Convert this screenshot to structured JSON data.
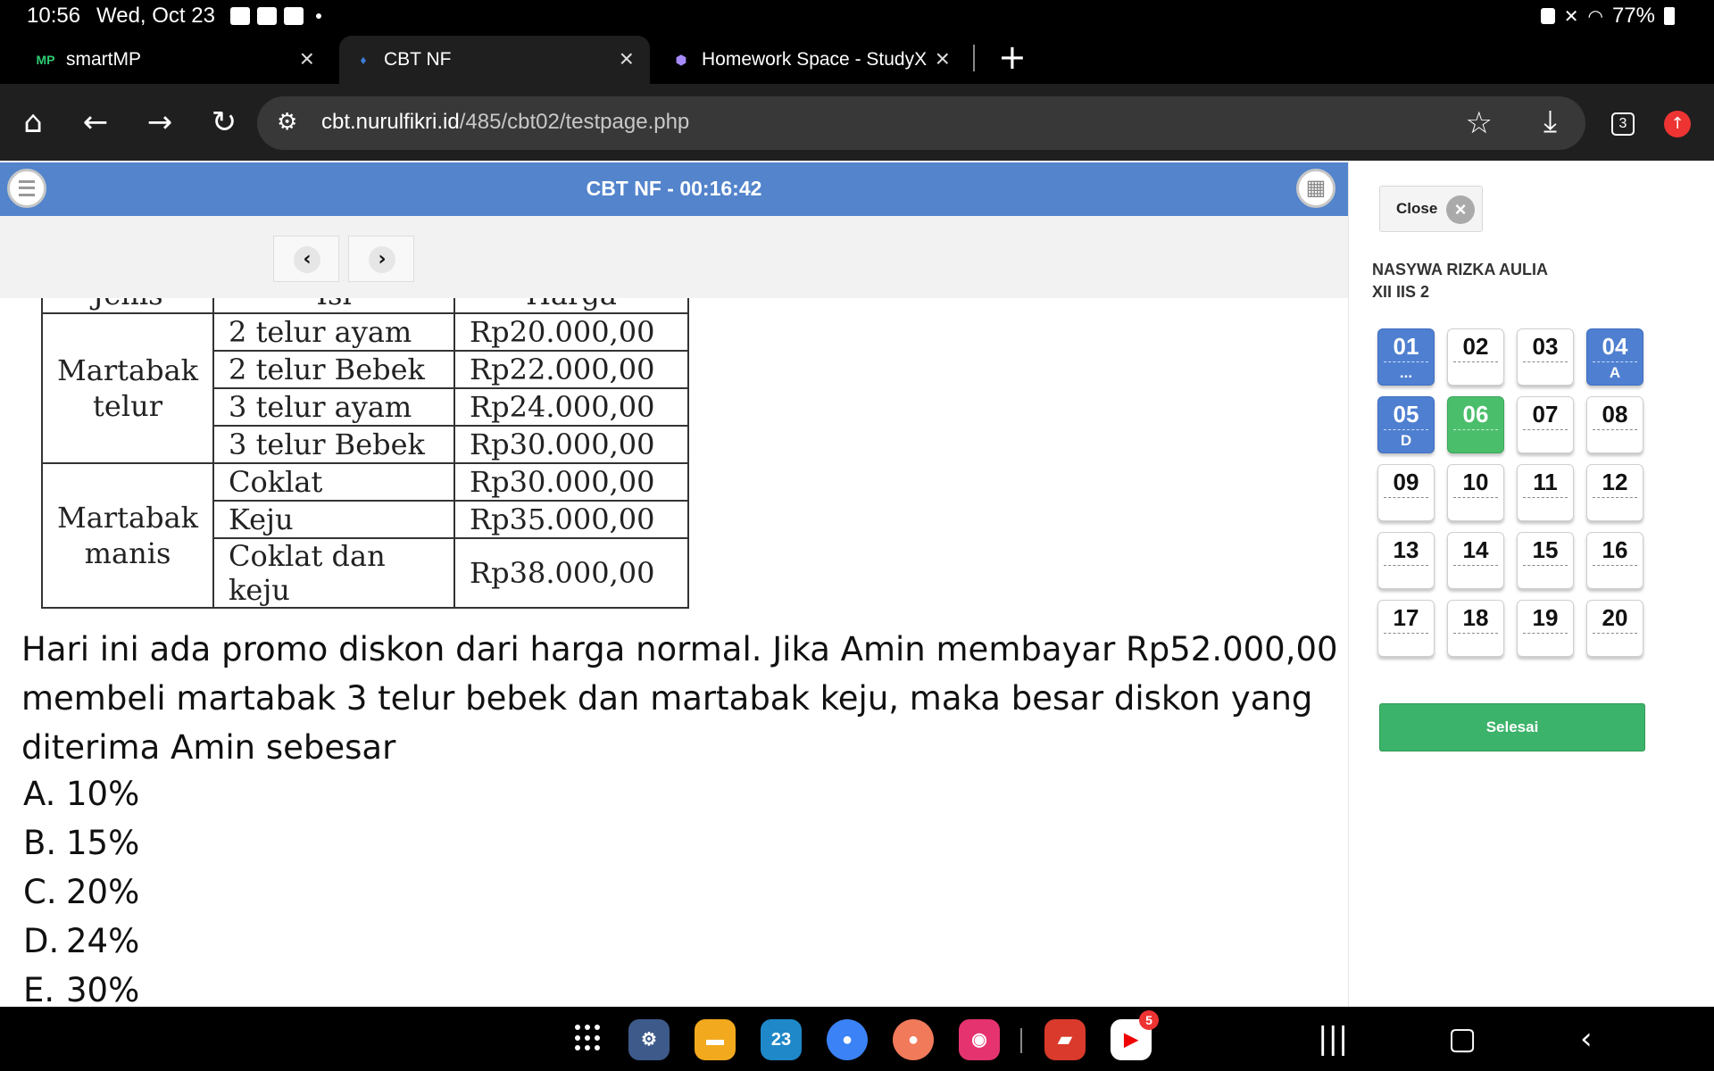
{
  "status_bar": {
    "time": "10:56",
    "date": "Wed, Oct 23",
    "battery": "77%"
  },
  "tabs": [
    {
      "title": "smartMP",
      "icon": "smartmp-favicon"
    },
    {
      "title": "CBT NF",
      "icon": "cbt-favicon"
    },
    {
      "title": "Homework Space - StudyX",
      "icon": "studyx-favicon"
    }
  ],
  "address_bar": {
    "domain": "cbt.nurulfikri.id",
    "path": "/485/cbt02/testpage.php"
  },
  "tab_count": "3",
  "exam": {
    "header": "CBT NF - 00:16:42"
  },
  "table": {
    "headers": [
      "Jenis",
      "Isi",
      "Harga"
    ],
    "groups": [
      {
        "category": "Martabak telur",
        "rows": [
          {
            "isi": "2 telur ayam",
            "harga": "Rp20.000,00"
          },
          {
            "isi": "2 telur Bebek",
            "harga": "Rp22.000,00"
          },
          {
            "isi": "3 telur ayam",
            "harga": "Rp24.000,00"
          },
          {
            "isi": "3 telur Bebek",
            "harga": "Rp30.000,00"
          }
        ]
      },
      {
        "category": "Martabak manis",
        "rows": [
          {
            "isi": "Coklat",
            "harga": "Rp30.000,00"
          },
          {
            "isi": "Keju",
            "harga": "Rp35.000,00"
          },
          {
            "isi": "Coklat dan keju",
            "harga": "Rp38.000,00"
          }
        ]
      }
    ]
  },
  "question": {
    "text": "Hari ini ada promo diskon dari harga normal. Jika Amin membayar Rp52.000,00 membeli martabak 3 telur bebek dan martabak keju, maka besar diskon yang diterima Amin sebesar",
    "options": [
      {
        "key": "A.",
        "text": "10%"
      },
      {
        "key": "B.",
        "text": "15%"
      },
      {
        "key": "C.",
        "text": "20%"
      },
      {
        "key": "D.",
        "text": "24%"
      },
      {
        "key": "E.",
        "text": "30%"
      }
    ]
  },
  "panel": {
    "close_label": "Close",
    "student_name": "NASYWA RIZKA AULIA",
    "student_class": "XII IIS 2",
    "questions": [
      {
        "num": "01",
        "answer": "...",
        "state": "answered"
      },
      {
        "num": "02",
        "answer": "",
        "state": "empty"
      },
      {
        "num": "03",
        "answer": "",
        "state": "empty"
      },
      {
        "num": "04",
        "answer": "A",
        "state": "answered"
      },
      {
        "num": "05",
        "answer": "D",
        "state": "answered"
      },
      {
        "num": "06",
        "answer": "",
        "state": "current"
      },
      {
        "num": "07",
        "answer": "",
        "state": "empty"
      },
      {
        "num": "08",
        "answer": "",
        "state": "empty"
      },
      {
        "num": "09",
        "answer": "",
        "state": "empty"
      },
      {
        "num": "10",
        "answer": "",
        "state": "empty"
      },
      {
        "num": "11",
        "answer": "",
        "state": "empty"
      },
      {
        "num": "12",
        "answer": "",
        "state": "empty"
      },
      {
        "num": "13",
        "answer": "",
        "state": "empty"
      },
      {
        "num": "14",
        "answer": "",
        "state": "empty"
      },
      {
        "num": "15",
        "answer": "",
        "state": "empty"
      },
      {
        "num": "16",
        "answer": "",
        "state": "empty"
      },
      {
        "num": "17",
        "answer": "",
        "state": "empty"
      },
      {
        "num": "18",
        "answer": "",
        "state": "empty"
      },
      {
        "num": "19",
        "answer": "",
        "state": "empty"
      },
      {
        "num": "20",
        "answer": "",
        "state": "empty"
      }
    ],
    "finish_label": "Selesai"
  },
  "taskbar": {
    "calendar_day": "23",
    "youtube_badge": "5",
    "apps": [
      "settings-app",
      "files-app",
      "calendar-app",
      "messages-app",
      "contacts-app",
      "camera-app",
      "notes-app",
      "youtube-app"
    ]
  },
  "colors": {
    "header": "#5384cc",
    "answered": "#4f7fd0",
    "current": "#4bbe6b",
    "finish": "#3cb36a"
  }
}
